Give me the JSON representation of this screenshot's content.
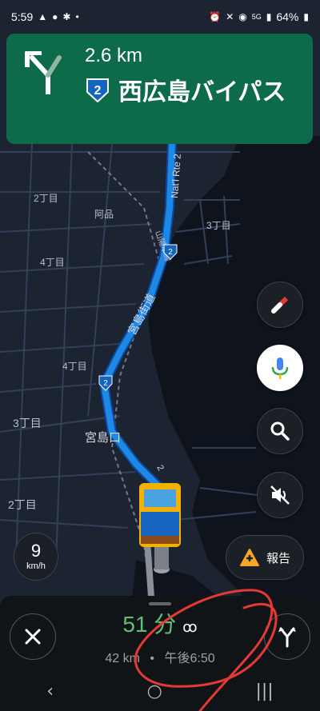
{
  "status_bar": {
    "time": "5:59",
    "left_icons": [
      "navigation-arrow-icon",
      "chat-icon",
      "cloud-icon",
      "dot-icon"
    ],
    "right_icons": [
      "alarm-icon",
      "mute-icon",
      "location-icon",
      "5g-icon",
      "signal-icon"
    ],
    "network": "5G",
    "battery": "64%"
  },
  "nav_banner": {
    "distance": "2.6 km",
    "route_number": "2",
    "street": "西広島バイパス",
    "color": "#0d6b4a",
    "maneuver_icon": "fork-left-icon"
  },
  "map": {
    "labels": {
      "nat_rte": "Nat'l Rte 2",
      "district_2_top": "2丁目",
      "agata": "阿品",
      "district_3_right": "3丁目",
      "district_4_top": "4丁目",
      "sanyo_line": "山陽本線",
      "miyajima_kaido": "宮島街道",
      "district_4_mid": "4丁目",
      "district_3_left": "3丁目",
      "miyajimaguchi": "宮島口",
      "district_2_bottom": "2丁目",
      "route_shield_1": "2",
      "route_shield_2": "2",
      "rte2_vertical": "2"
    },
    "route_color": "#1e88e5"
  },
  "controls": {
    "compass_icon": "compass-icon",
    "mic_icon": "microphone-icon",
    "search_icon": "search-icon",
    "sound_icon": "sound-off-icon",
    "speed": {
      "value": "9",
      "unit": "km/h"
    },
    "report_label": "報告"
  },
  "bottom_panel": {
    "eta_duration": "51 分",
    "eta_distance": "42 km",
    "eta_separator": "•",
    "eta_arrival": "午後6:50",
    "close_icon": "close-icon",
    "alt_routes_icon": "alternate-routes-icon"
  },
  "android_nav": {
    "back": "‹",
    "home": "○",
    "recents": "|||"
  }
}
